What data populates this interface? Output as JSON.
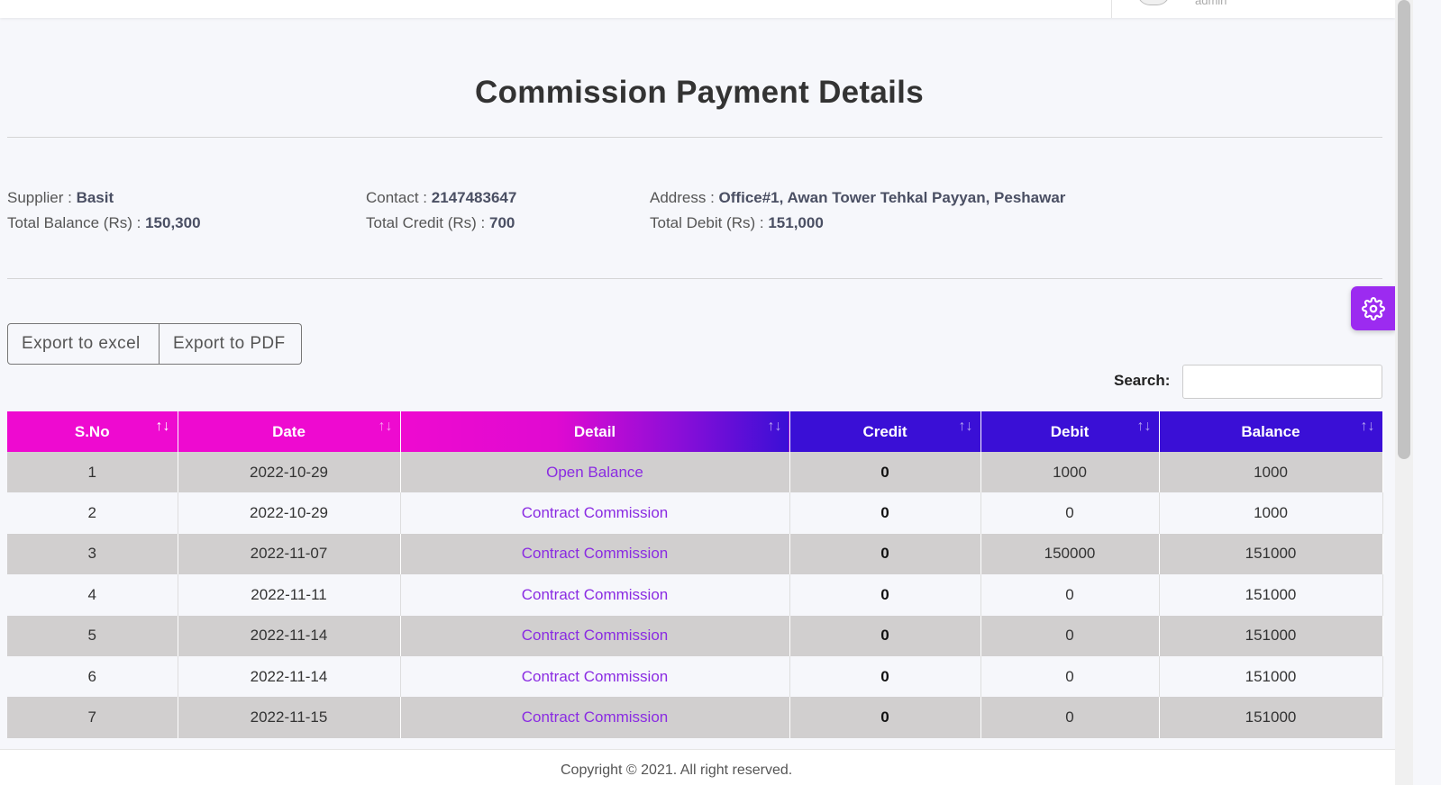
{
  "topbar": {
    "user_name": "admin"
  },
  "page": {
    "title": "Commission Payment Details"
  },
  "supplier_info": {
    "supplier_label": "Supplier :",
    "supplier_value": "Basit",
    "total_balance_label": "Total Balance (Rs) :",
    "total_balance_value": "150,300",
    "contact_label": "Contact :",
    "contact_value": "2147483647",
    "total_credit_label": "Total Credit (Rs) :",
    "total_credit_value": "700",
    "address_label": "Address :",
    "address_value": "Office#1, Awan Tower Tehkal Payyan, Peshawar",
    "total_debit_label": "Total Debit (Rs) :",
    "total_debit_value": "151,000"
  },
  "toolbar": {
    "export_excel_label": "Export to excel",
    "export_pdf_label": "Export to PDF",
    "search_label": "Search:",
    "search_value": ""
  },
  "table": {
    "columns": [
      "S.No",
      "Date",
      "Detail",
      "Credit",
      "Debit",
      "Balance"
    ],
    "rows": [
      [
        "1",
        "2022-10-29",
        "Open Balance",
        "0",
        "1000",
        "1000"
      ],
      [
        "2",
        "2022-10-29",
        "Contract Commission",
        "0",
        "0",
        "1000"
      ],
      [
        "3",
        "2022-11-07",
        "Contract Commission",
        "0",
        "150000",
        "151000"
      ],
      [
        "4",
        "2022-11-11",
        "Contract Commission",
        "0",
        "0",
        "151000"
      ],
      [
        "5",
        "2022-11-14",
        "Contract Commission",
        "0",
        "0",
        "151000"
      ],
      [
        "6",
        "2022-11-14",
        "Contract Commission",
        "0",
        "0",
        "151000"
      ],
      [
        "7",
        "2022-11-15",
        "Contract Commission",
        "0",
        "0",
        "151000"
      ]
    ]
  },
  "footer": {
    "text": "Copyright © 2021. All right reserved."
  },
  "colors": {
    "header_pink": "#ee0ad0",
    "header_indigo": "#3a0fd6",
    "link_purple": "#8a2be2",
    "settings_purple": "#9c2bf0",
    "row_gray": "#d1cfcf"
  },
  "icons": {
    "settings": "gear-icon",
    "sort": "sort-arrows-icon"
  }
}
